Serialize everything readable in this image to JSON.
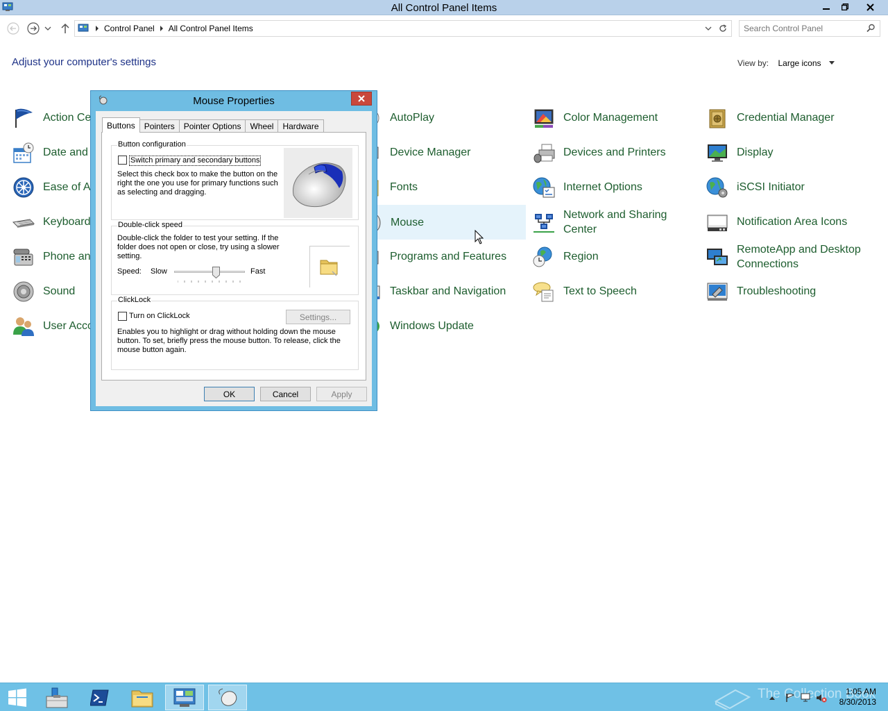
{
  "window": {
    "title": "All Control Panel Items"
  },
  "address": {
    "crumbs": [
      "Control Panel",
      "All Control Panel Items"
    ],
    "search_placeholder": "Search Control Panel"
  },
  "content": {
    "heading": "Adjust your computer's settings",
    "view_by_label": "View by:",
    "view_by_value": "Large icons"
  },
  "items": {
    "col1": [
      "Action Center",
      "Date and Time",
      "Ease of Access Center",
      "Keyboard",
      "Phone and Modem",
      "Sound",
      "User Accounts"
    ],
    "col2": [
      "AutoPlay",
      "Device Manager",
      "Fonts",
      "Mouse",
      "Programs and Features",
      "Taskbar and Navigation",
      "Windows Update"
    ],
    "col3": [
      "Color Management",
      "Devices and Printers",
      "Internet Options",
      "Network and Sharing Center",
      "Region",
      "Text to Speech"
    ],
    "col4": [
      "Credential Manager",
      "Display",
      "iSCSI Initiator",
      "Notification Area Icons",
      "RemoteApp and Desktop Connections",
      "Troubleshooting"
    ]
  },
  "dialog": {
    "title": "Mouse Properties",
    "tabs": [
      "Buttons",
      "Pointers",
      "Pointer Options",
      "Wheel",
      "Hardware"
    ],
    "button_config": {
      "label": "Button configuration",
      "checkbox": "Switch primary and secondary buttons",
      "description": "Select this check box to make the button on the right the one you use for primary functions such as selecting and dragging."
    },
    "double_click": {
      "label": "Double-click speed",
      "description": "Double-click the folder to test your setting. If the folder does not open or close, try using a slower setting.",
      "speed_label": "Speed:",
      "slow": "Slow",
      "fast": "Fast",
      "speed_level": 0.6
    },
    "clicklock": {
      "label": "ClickLock",
      "checkbox": "Turn on ClickLock",
      "settings_button": "Settings...",
      "description": "Enables you to highlight or drag without holding down the mouse button. To set, briefly press the mouse button. To release, click the mouse button again."
    },
    "buttons": {
      "ok": "OK",
      "cancel": "Cancel",
      "apply": "Apply"
    }
  },
  "taskbar": {
    "time": "1:05 AM",
    "date": "8/30/2013",
    "watermark": "The Collection Book"
  }
}
